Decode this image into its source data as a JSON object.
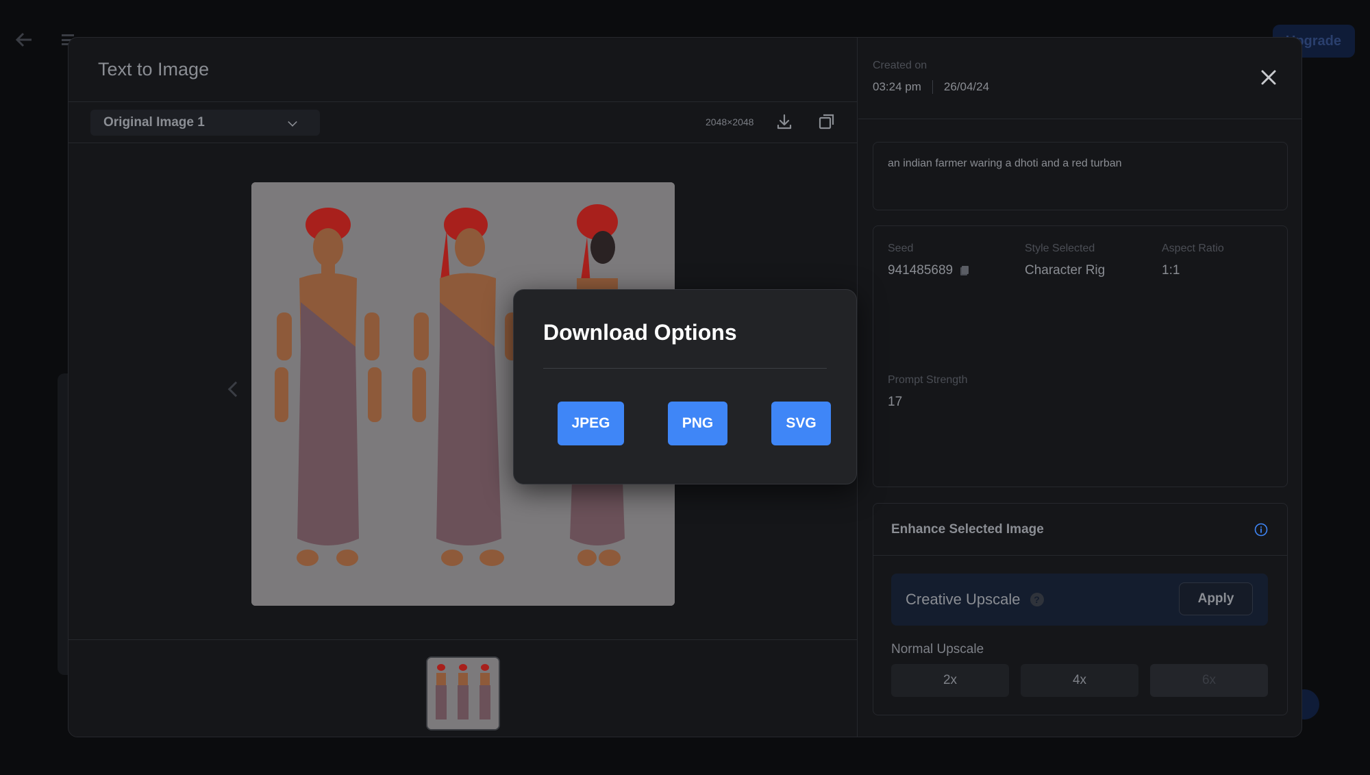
{
  "modal": {
    "title": "Text to Image",
    "image_select": "Original Image 1",
    "dimensions": "2048×2048"
  },
  "details": {
    "created_label": "Created on",
    "created_time": "03:24 pm",
    "created_date": "26/04/24",
    "prompt": "an indian farmer waring a dhoti and a red turban",
    "seed_label": "Seed",
    "seed_value": "941485689",
    "style_label": "Style Selected",
    "style_value": "Character Rig",
    "aspect_label": "Aspect Ratio",
    "aspect_value": "1:1",
    "strength_label": "Prompt Strength",
    "strength_value": "17"
  },
  "enhance": {
    "title": "Enhance Selected Image",
    "creative_label": "Creative Upscale",
    "help_glyph": "?",
    "apply_label": "Apply",
    "normal_label": "Normal Upscale",
    "options": [
      "2x",
      "4x",
      "6x"
    ]
  },
  "download_popup": {
    "title": "Download Options",
    "formats": [
      "JPEG",
      "PNG",
      "SVG"
    ]
  },
  "background": {
    "upgrade_label": "Upgrade"
  },
  "colors": {
    "accent": "#3f86f7",
    "modal_bg": "#151619",
    "turban": "#a8201c",
    "dhoti": "#6b5159",
    "skin": "#8e5a3a"
  },
  "icons": [
    "back-arrow-icon",
    "menu-icon",
    "chevron-down-icon",
    "download-icon",
    "copy-icon",
    "close-icon",
    "info-icon",
    "chevron-left-icon"
  ]
}
